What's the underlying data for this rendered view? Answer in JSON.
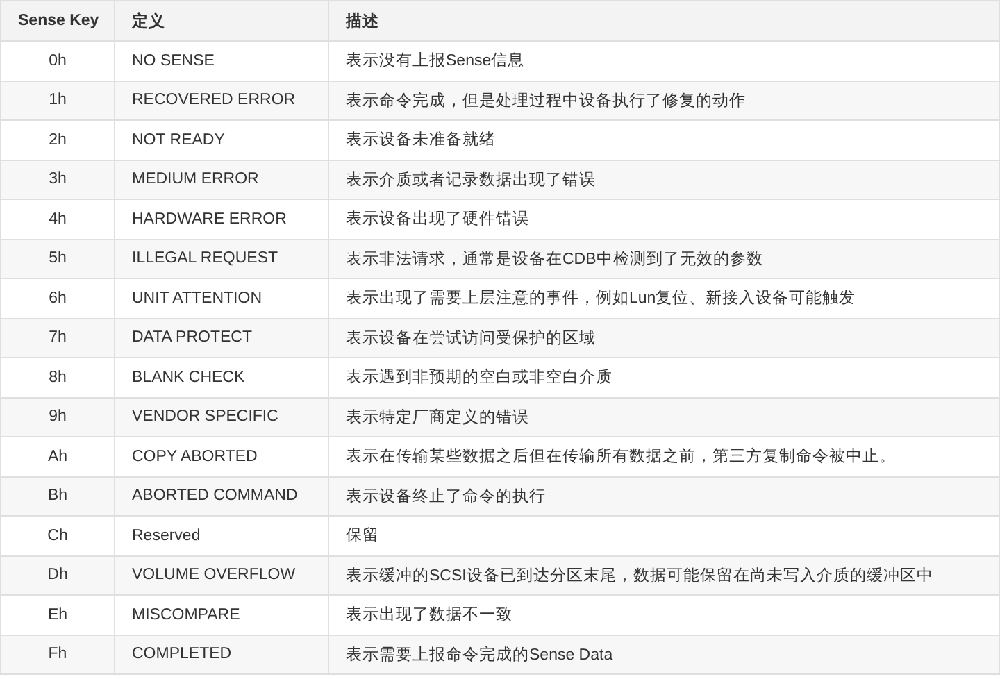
{
  "table": {
    "columns": [
      "Sense Key",
      "定义",
      "描述"
    ],
    "rows": [
      {
        "key": "0h",
        "name": "NO SENSE",
        "desc": "表示没有上报Sense信息"
      },
      {
        "key": "1h",
        "name": "RECOVERED ERROR",
        "desc": "表示命令完成，但是处理过程中设备执行了修复的动作"
      },
      {
        "key": "2h",
        "name": "NOT READY",
        "desc": "表示设备未准备就绪"
      },
      {
        "key": "3h",
        "name": "MEDIUM ERROR",
        "desc": "表示介质或者记录数据出现了错误"
      },
      {
        "key": "4h",
        "name": "HARDWARE ERROR",
        "desc": "表示设备出现了硬件错误"
      },
      {
        "key": "5h",
        "name": "ILLEGAL REQUEST",
        "desc": "表示非法请求，通常是设备在CDB中检测到了无效的参数"
      },
      {
        "key": "6h",
        "name": "UNIT ATTENTION",
        "desc": "表示出现了需要上层注意的事件，例如Lun复位、新接入设备可能触发"
      },
      {
        "key": "7h",
        "name": "DATA PROTECT",
        "desc": "表示设备在尝试访问受保护的区域"
      },
      {
        "key": "8h",
        "name": "BLANK CHECK",
        "desc": "表示遇到非预期的空白或非空白介质"
      },
      {
        "key": "9h",
        "name": "VENDOR SPECIFIC",
        "desc": "表示特定厂商定义的错误"
      },
      {
        "key": "Ah",
        "name": "COPY ABORTED",
        "desc": "表示在传输某些数据之后但在传输所有数据之前，第三方复制命令被中止。"
      },
      {
        "key": "Bh",
        "name": "ABORTED COMMAND",
        "desc": "表示设备终止了命令的执行"
      },
      {
        "key": "Ch",
        "name": "Reserved",
        "desc": "保留"
      },
      {
        "key": "Dh",
        "name": "VOLUME OVERFLOW",
        "desc": "表示缓冲的SCSI设备已到达分区末尾，数据可能保留在尚未写入介质的缓冲区中"
      },
      {
        "key": "Eh",
        "name": "MISCOMPARE",
        "desc": "表示出现了数据不一致"
      },
      {
        "key": "Fh",
        "name": "COMPLETED",
        "desc": "表示需要上报命令完成的Sense Data"
      }
    ]
  }
}
